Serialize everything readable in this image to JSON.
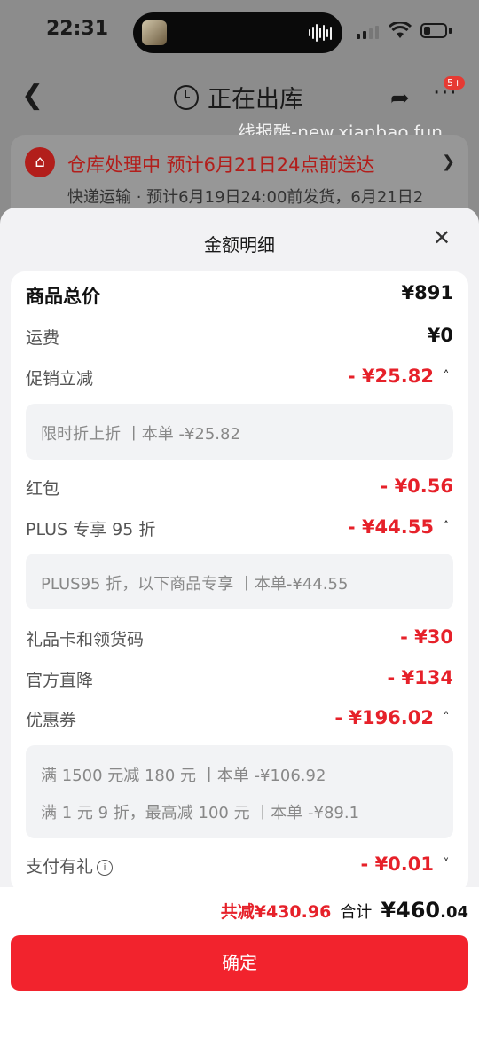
{
  "status_bar": {
    "time": "22:31"
  },
  "nav": {
    "back_icon": "chevron-left-icon",
    "title": "正在出库",
    "more_badge": "5+"
  },
  "watermark": "线报酷-new.xianbao.fun",
  "order": {
    "status": "仓库处理中 预计6月21日24点前送达",
    "sub": "快递运输 · 预计6月19日24:00前发货，6月21日2"
  },
  "sheet": {
    "title": "金额明细",
    "rows": {
      "goods_total": {
        "label": "商品总价",
        "value": "¥891"
      },
      "shipping": {
        "label": "运费",
        "value": "¥0"
      },
      "promo": {
        "label": "促销立减",
        "value": "- ¥25.82",
        "detail": "限时折上折 丨本单 -¥25.82"
      },
      "red_packet": {
        "label": "红包",
        "value": "- ¥0.56"
      },
      "plus": {
        "label": "PLUS 专享 95 折",
        "value": "- ¥44.55",
        "detail": "PLUS95 折，以下商品专享 丨本单-¥44.55"
      },
      "gift_card": {
        "label": "礼品卡和领货码",
        "value": "- ¥30"
      },
      "official_drop": {
        "label": "官方直降",
        "value": "- ¥134"
      },
      "coupon": {
        "label": "优惠券",
        "value": "- ¥196.02",
        "detail_1": "满 1500 元减 180 元 丨本单 -¥106.92",
        "detail_2": "满 1 元 9 折，最高减 100 元 丨本单 -¥89.1"
      },
      "pay_gift": {
        "label": "支付有礼",
        "value": "- ¥0.01"
      }
    }
  },
  "footer": {
    "saved": "共减¥430.96",
    "sum_label": "合计",
    "sum_int": "¥460",
    "sum_dec": ".04",
    "confirm": "确定"
  },
  "colors": {
    "accent": "#f2232d",
    "price_red": "#e6212a"
  }
}
